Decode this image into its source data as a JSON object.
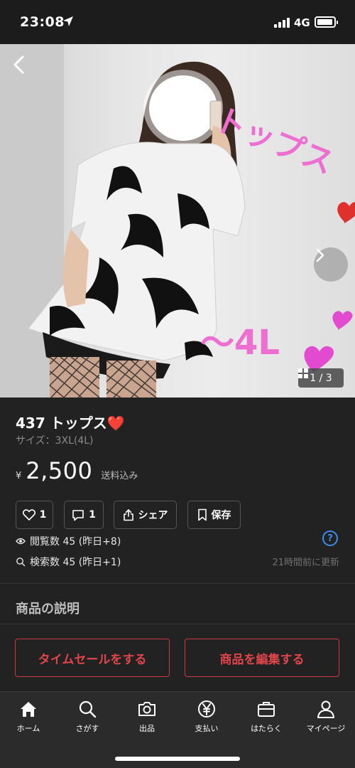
{
  "status_bar": {
    "time": "23:08",
    "network": "4G"
  },
  "hero": {
    "overlay_text_top": "トップス",
    "overlay_text_bottom": "〜4L",
    "image_counter": "1 / 3"
  },
  "product": {
    "title": "437 トップス❤️",
    "size": "サイズ：3XL(4L)",
    "currency": "¥",
    "price": "2,500",
    "shipping": "送料込み"
  },
  "actions": {
    "like_count": "1",
    "comment_count": "1",
    "share_label": "シェア",
    "save_label": "保存"
  },
  "stats": {
    "views": "閲覧数  45 (昨日+8)",
    "searches": "検索数  45 (昨日+1)",
    "updated": "21時間前に更新",
    "help": "?"
  },
  "description": {
    "heading": "商品の説明"
  },
  "buttons": {
    "timesale": "タイムセールをする",
    "edit": "商品を編集する"
  },
  "tabs": [
    {
      "label": "ホーム",
      "icon": "home-icon"
    },
    {
      "label": "さがす",
      "icon": "search-icon"
    },
    {
      "label": "出品",
      "icon": "camera-icon"
    },
    {
      "label": "支払い",
      "icon": "yen-icon"
    },
    {
      "label": "はたらく",
      "icon": "briefcase-icon"
    },
    {
      "label": "マイページ",
      "icon": "person-icon"
    }
  ],
  "colors": {
    "background": "#222222",
    "accent_red": "#e0454a",
    "help_blue": "#3a8ee6",
    "overlay_pink": "#ec6fd1"
  }
}
